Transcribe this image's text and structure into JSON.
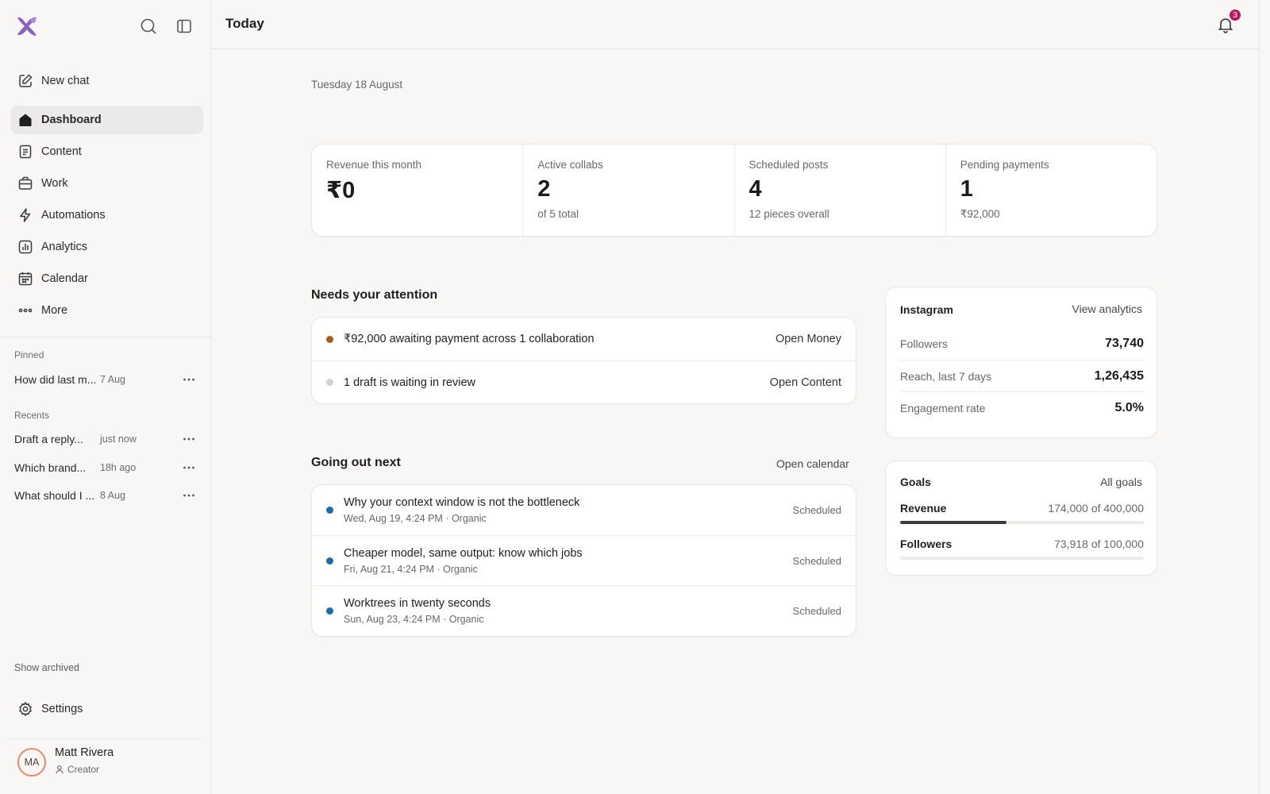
{
  "sidebar": {
    "new_chat": "New chat",
    "nav": [
      {
        "label": "Dashboard",
        "icon": "home-icon",
        "active": true
      },
      {
        "label": "Content",
        "icon": "document-icon"
      },
      {
        "label": "Work",
        "icon": "briefcase-icon"
      },
      {
        "label": "Automations",
        "icon": "bolt-icon"
      },
      {
        "label": "Analytics",
        "icon": "chart-icon"
      },
      {
        "label": "Calendar",
        "icon": "calendar-icon"
      },
      {
        "label": "More",
        "icon": "more-icon"
      }
    ],
    "pinned_label": "Pinned",
    "pinned": [
      {
        "title": "How did last m...",
        "time": "7 Aug"
      }
    ],
    "recents_label": "Recents",
    "recents": [
      {
        "title": "Draft a reply...",
        "time": "just now"
      },
      {
        "title": "Which brand...",
        "time": "18h ago"
      },
      {
        "title": "What should I ...",
        "time": "8 Aug"
      }
    ],
    "show_archived": "Show archived",
    "settings": "Settings",
    "user": {
      "initials": "MA",
      "name": "Matt Rivera",
      "role": "Creator"
    }
  },
  "header": {
    "title": "Today",
    "notification_count": "3"
  },
  "date": "Tuesday 18 August",
  "stats": [
    {
      "label": "Revenue this month",
      "value": "₹0",
      "sub": ""
    },
    {
      "label": "Active collabs",
      "value": "2",
      "sub": "of 5 total"
    },
    {
      "label": "Scheduled posts",
      "value": "4",
      "sub": "12 pieces overall"
    },
    {
      "label": "Pending payments",
      "value": "1",
      "sub": "₹92,000"
    }
  ],
  "attention": {
    "title": "Needs your attention",
    "items": [
      {
        "text": "₹92,000 awaiting payment across 1 collaboration",
        "action": "Open Money",
        "dot": "#a85d12"
      },
      {
        "text": "1 draft is waiting in review",
        "action": "Open Content",
        "dot": "#d4d2cf"
      }
    ]
  },
  "next": {
    "title": "Going out next",
    "link": "Open calendar",
    "items": [
      {
        "title": "Why your context window is not the bottleneck",
        "meta": "Wed, Aug 19, 4:24 PM · Organic",
        "status": "Scheduled"
      },
      {
        "title": "Cheaper model, same output: know which jobs",
        "meta": "Fri, Aug 21, 4:24 PM · Organic",
        "status": "Scheduled"
      },
      {
        "title": "Worktrees in twenty seconds",
        "meta": "Sun, Aug 23, 4:24 PM · Organic",
        "status": "Scheduled"
      }
    ]
  },
  "instagram": {
    "title": "Instagram",
    "link": "View analytics",
    "metrics": [
      {
        "label": "Followers",
        "value": "73,740"
      },
      {
        "label": "Reach, last 7 days",
        "value": "1,26,435"
      },
      {
        "label": "Engagement rate",
        "value": "5.0%"
      }
    ]
  },
  "goals": {
    "title": "Goals",
    "link": "All goals",
    "items": [
      {
        "name": "Revenue",
        "value": "174,000 of 400,000",
        "progress": 0.435
      },
      {
        "name": "Followers",
        "value": "73,918 of 100,000",
        "progress": 0.0
      }
    ]
  },
  "colors": {
    "accent": "#8b5fbf",
    "badge": "#c2185b",
    "post_dot": "#1a6fa8"
  }
}
